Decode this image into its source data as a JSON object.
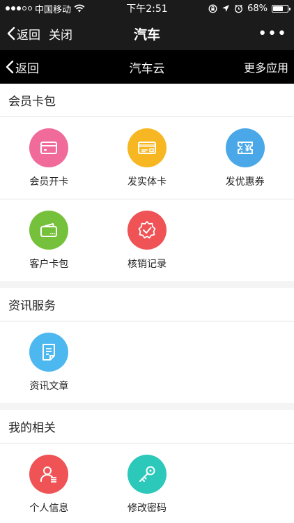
{
  "status_bar": {
    "carrier": "中国移动",
    "time": "下午2:51",
    "battery": "68%",
    "battery_level": 0.68
  },
  "wechat_nav": {
    "back_label": "返回",
    "close_label": "关闭",
    "title": "汽车",
    "more_label": "•••"
  },
  "app_nav": {
    "back_label": "返回",
    "title": "汽车云",
    "more_label": "更多应用"
  },
  "sections": {
    "membership": {
      "title": "会员卡包",
      "items": [
        {
          "label": "会员开卡",
          "icon": "card-icon",
          "color": "#f06a9a"
        },
        {
          "label": "发实体卡",
          "icon": "physical-card-icon",
          "color": "#f7b723"
        },
        {
          "label": "发优惠券",
          "icon": "coupon-icon",
          "color": "#4aa8e8"
        },
        {
          "label": "客户卡包",
          "icon": "wallet-icon",
          "color": "#76c13b"
        },
        {
          "label": "核销记录",
          "icon": "verify-badge-icon",
          "color": "#ef5356"
        }
      ]
    },
    "news": {
      "title": "资讯服务",
      "items": [
        {
          "label": "资讯文章",
          "icon": "article-icon",
          "color": "#4db8ef"
        }
      ]
    },
    "mine": {
      "title": "我的相关",
      "items": [
        {
          "label": "个人信息",
          "icon": "user-icon",
          "color": "#ef5356"
        },
        {
          "label": "修改密码",
          "icon": "key-icon",
          "color": "#2cc9bb"
        }
      ]
    }
  }
}
